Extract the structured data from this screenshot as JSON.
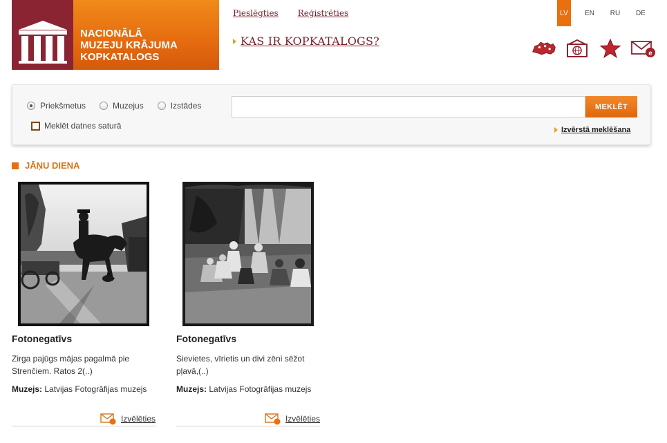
{
  "logo": {
    "lines": [
      "NACIONĀLĀ",
      "MUZEJU KRĀJUMA",
      "KOPKATALOGS"
    ]
  },
  "top_links": {
    "login": "Pieslēgties",
    "register": "Reģistrēties"
  },
  "what_is": "KAS IR KOPKATALOGS?",
  "languages": [
    {
      "code": "LV",
      "active": true
    },
    {
      "code": "EN",
      "active": false
    },
    {
      "code": "RU",
      "active": false
    },
    {
      "code": "DE",
      "active": false
    }
  ],
  "header_icons": [
    "latvia-map-icon",
    "museum-web-icon",
    "star-icon",
    "email-icon"
  ],
  "search": {
    "radios": [
      {
        "label": "Priekšmetus",
        "checked": true
      },
      {
        "label": "Muzejus",
        "checked": false
      },
      {
        "label": "Izstādes",
        "checked": false
      }
    ],
    "checkbox_label": "Meklēt datnes saturā",
    "input_value": "",
    "button_label": "MEKLĒT",
    "advanced_link": "Izvērstā meklēšana"
  },
  "section": {
    "title": "JĀŅU DIENA"
  },
  "cards": [
    {
      "type": "Fotonegatīvs",
      "description": "Zirga pajūgs mājas pagalmā pie Strenčiem. Ratos 2(..)",
      "museum_label": "Muzejs:",
      "museum_name": "Latvijas Fotogrāfijas muzejs",
      "select_label": "Izvēlēties"
    },
    {
      "type": "Fotonegatīvs",
      "description": "Sievietes, vīrietis un divi zēni sēžot pļavā,(..)",
      "museum_label": "Muzejs:",
      "museum_name": "Latvijas Fotogrāfijas muzejs",
      "select_label": "Izvēlēties"
    }
  ],
  "colors": {
    "brand_orange": "#e8700f",
    "brand_maroon": "#8a2433",
    "link_maroon": "#7a1f2a"
  }
}
